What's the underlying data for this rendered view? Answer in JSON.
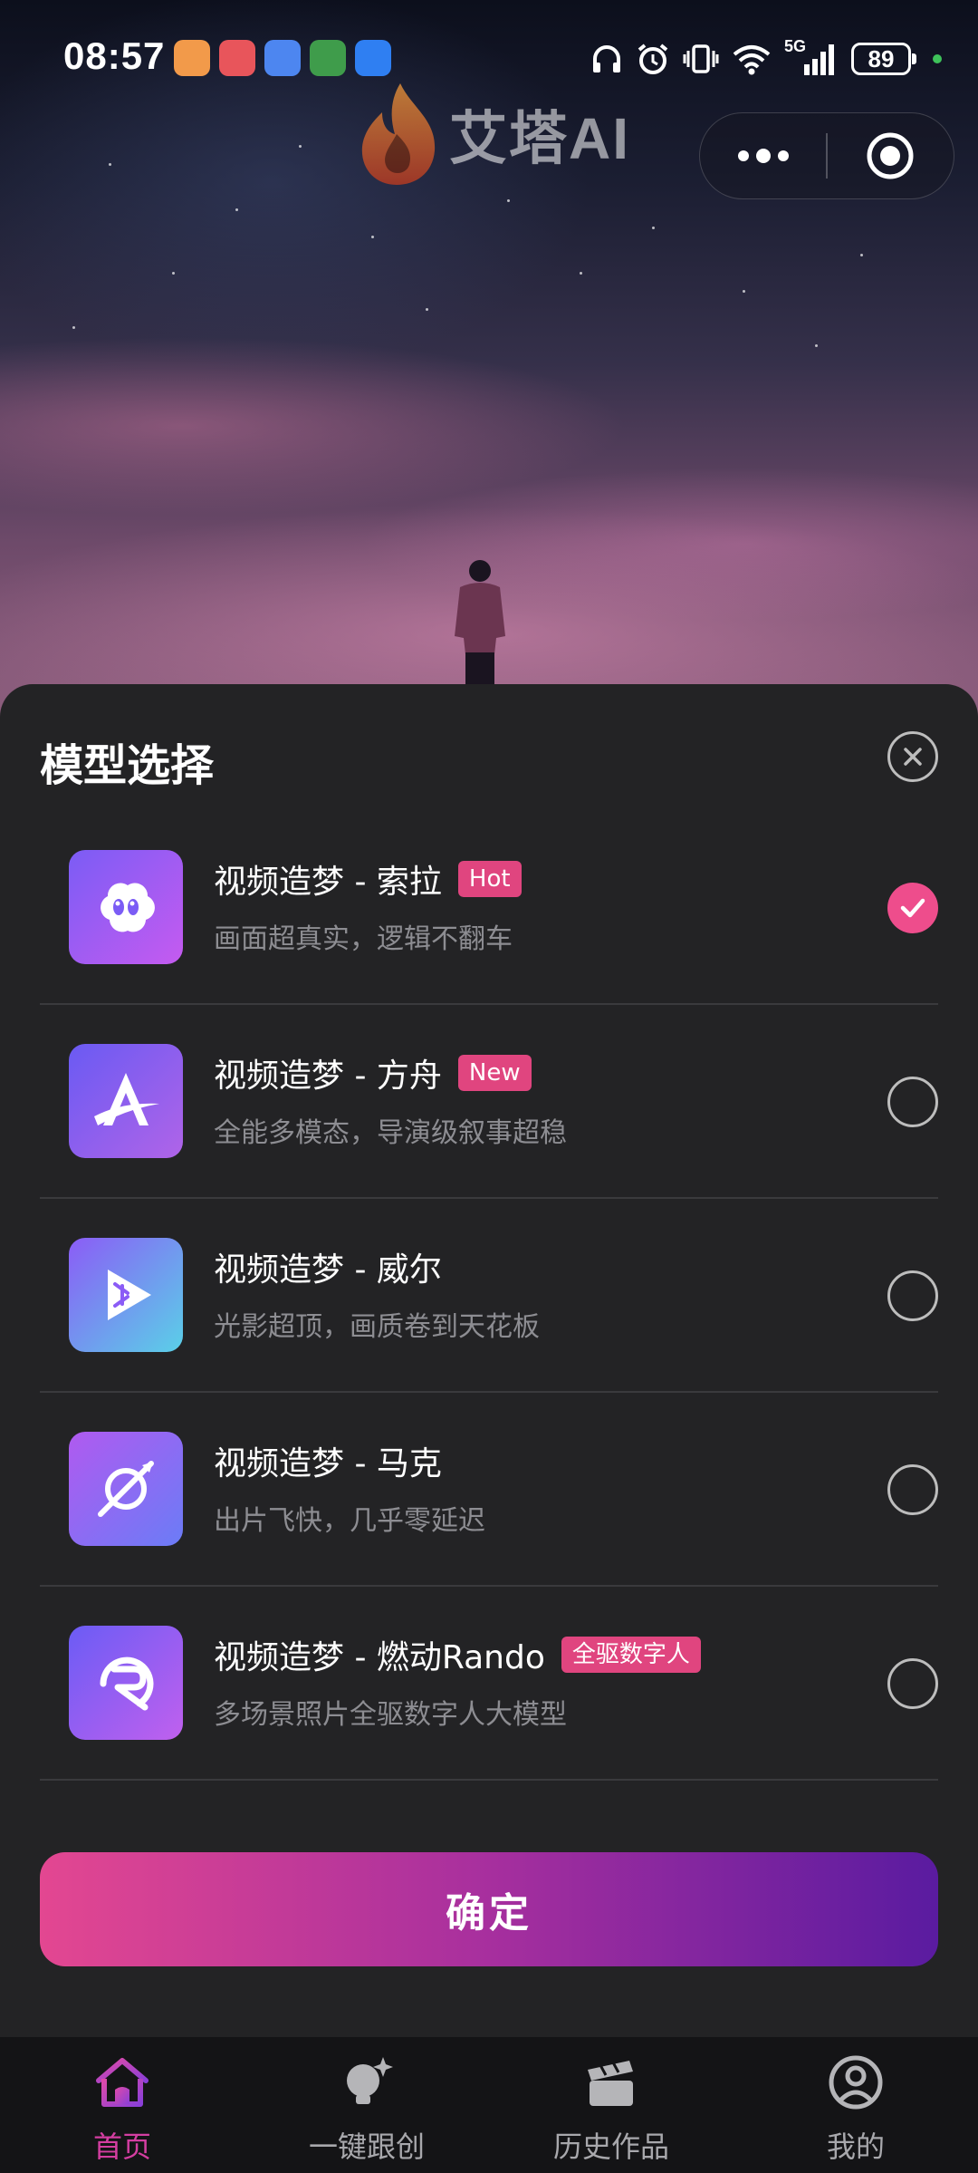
{
  "status_bar": {
    "time": "08:57",
    "network": "5G",
    "battery": "89"
  },
  "header": {
    "brand_name": "艾塔AI",
    "menu_icon": "more-dots-icon",
    "close_icon": "target-circle-icon"
  },
  "sheet": {
    "title": "模型选择",
    "models": [
      {
        "name": "视频造梦 - 索拉",
        "badge": "Hot",
        "desc": "画面超真实，逻辑不翻车",
        "icon": "cloud-face-icon",
        "selected": true
      },
      {
        "name": "视频造梦 - 方舟",
        "badge": "New",
        "desc": "全能多模态，导演级叙事超稳",
        "icon": "letter-a-swoosh-icon",
        "selected": false
      },
      {
        "name": "视频造梦 - 威尔",
        "badge": "",
        "desc": "光影超顶，画质卷到天花板",
        "icon": "play-puzzle-icon",
        "selected": false
      },
      {
        "name": "视频造梦 - 马克",
        "badge": "",
        "desc": "出片飞快，几乎零延迟",
        "icon": "orbit-slash-icon",
        "selected": false
      },
      {
        "name": "视频造梦 - 燃动Rando",
        "badge": "全驱数字人",
        "desc": "多场景照片全驱数字人大模型",
        "icon": "letter-r-swirl-icon",
        "selected": false
      }
    ],
    "confirm_label": "确定"
  },
  "tab_bar": {
    "tabs": [
      {
        "label": "首页",
        "icon": "home-icon",
        "active": true
      },
      {
        "label": "一键跟创",
        "icon": "bulb-sparkle-icon",
        "active": false
      },
      {
        "label": "历史作品",
        "icon": "clapperboard-icon",
        "active": false
      },
      {
        "label": "我的",
        "icon": "user-circle-icon",
        "active": false
      }
    ]
  },
  "colors": {
    "accent_pink": "#ee4d8c",
    "badge_pink": "#e0457f",
    "active_tab": "#d43ea1",
    "sheet_bg": "#232325"
  }
}
